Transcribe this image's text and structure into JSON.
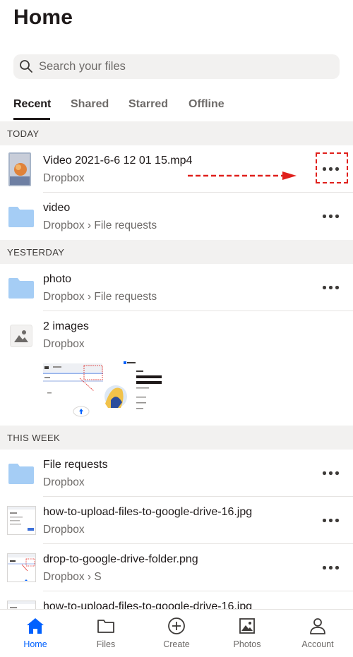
{
  "header": {
    "title": "Home"
  },
  "search": {
    "placeholder": "Search your files"
  },
  "tabs": [
    {
      "label": "Recent",
      "active": true
    },
    {
      "label": "Shared",
      "active": false
    },
    {
      "label": "Starred",
      "active": false
    },
    {
      "label": "Offline",
      "active": false
    }
  ],
  "sections": {
    "today": "TODAY",
    "yesterday": "YESTERDAY",
    "this_week": "THIS WEEK"
  },
  "items": [
    {
      "name": "Video 2021-6-6 12 01 15.mp4",
      "path": "Dropbox",
      "icon": "video-thumbnail-icon"
    },
    {
      "name": "video",
      "path": "Dropbox › File requests",
      "icon": "folder-icon"
    },
    {
      "name": "photo",
      "path": "Dropbox › File requests",
      "icon": "folder-icon"
    },
    {
      "name": "2 images",
      "path": "Dropbox",
      "icon": "image-icon"
    },
    {
      "name": "File requests",
      "path": "Dropbox",
      "icon": "folder-icon"
    },
    {
      "name": "how-to-upload-files-to-google-drive-16.jpg",
      "path": "Dropbox",
      "icon": "screenshot-thumbnail-icon"
    },
    {
      "name": "drop-to-google-drive-folder.png",
      "path": "Dropbox › S",
      "icon": "screenshot-thumbnail-icon"
    },
    {
      "name": "how-to-upload-files-to-google-drive-16.jpg",
      "path": "",
      "icon": "screenshot-thumbnail-icon"
    }
  ],
  "nav": [
    {
      "label": "Home",
      "icon": "home-icon",
      "active": true
    },
    {
      "label": "Files",
      "icon": "folder-outline-icon",
      "active": false
    },
    {
      "label": "Create",
      "icon": "plus-circle-icon",
      "active": false
    },
    {
      "label": "Photos",
      "icon": "photo-icon",
      "active": false
    },
    {
      "label": "Account",
      "icon": "person-icon",
      "active": false
    }
  ],
  "colors": {
    "accent": "#0061fe",
    "folder": "#a5cdf5",
    "annotation": "#e0201c",
    "section_bg": "#f2f1f0"
  }
}
